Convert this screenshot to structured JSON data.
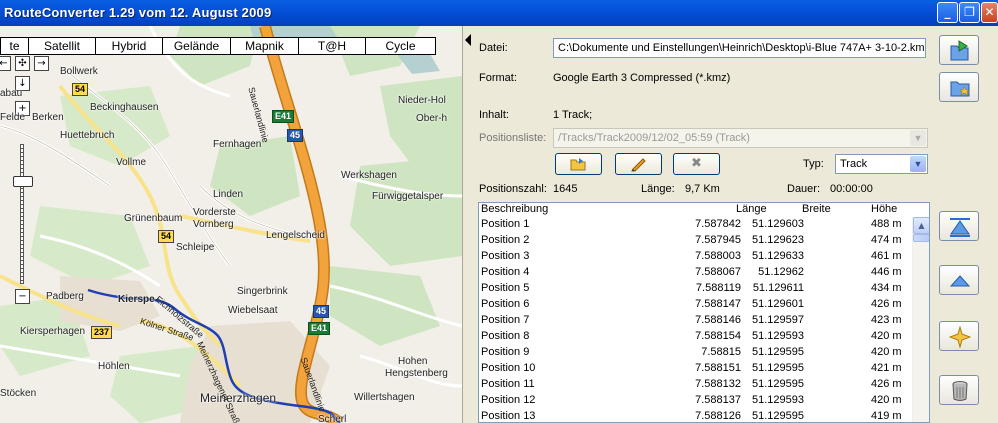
{
  "window": {
    "title": "RouteConverter 1.29 vom 12. August 2009",
    "minimize_icon": "minimize-icon",
    "maximize_icon": "maximize-icon",
    "close_icon": "close-icon"
  },
  "map": {
    "tabs": [
      "te",
      "Satellit",
      "Hybrid",
      "Gelände",
      "Mapnik",
      "T@H",
      "Cycle"
    ],
    "places": [
      {
        "name": "Bollwerk"
      },
      {
        "name": "Beckinghausen"
      },
      {
        "name": "Huettebruch"
      },
      {
        "name": "Vollme"
      },
      {
        "name": "Fernhagen"
      },
      {
        "name": "Linden"
      },
      {
        "name": "Grünenbaum"
      },
      {
        "name": "Vorderste"
      },
      {
        "name": "Vornberg"
      },
      {
        "name": "Schleipe"
      },
      {
        "name": "Lengelscheid"
      },
      {
        "name": "Werkshagen"
      },
      {
        "name": "Fürwiggetalsper"
      },
      {
        "name": "Nieder-Hol"
      },
      {
        "name": "Ober-h"
      },
      {
        "name": "Singerbrink"
      },
      {
        "name": "Wiebelsaat"
      },
      {
        "name": "Padberg"
      },
      {
        "name": "Kierspe"
      },
      {
        "name": "Kiersperhagen"
      },
      {
        "name": "Höhlen"
      },
      {
        "name": "Meinerzhagen"
      },
      {
        "name": "Hohen"
      },
      {
        "name": "Hengstenberg"
      },
      {
        "name": "Willertshagen"
      },
      {
        "name": "Stöcken"
      },
      {
        "name": "Scherl"
      },
      {
        "name": "Felde"
      },
      {
        "name": "Berken"
      },
      {
        "name": "abau"
      }
    ],
    "roads": {
      "a45_name": "Sauerlandlinie",
      "street1": "Kölner Straße",
      "street2": "Meinerzhagener Straße",
      "street3": "Eichholzstraße"
    },
    "shields": {
      "s54a": "54",
      "s54b": "54",
      "s237": "237",
      "e41a": "E41",
      "a45a": "45",
      "a45b": "45",
      "e41b": "E41"
    },
    "colors": {
      "motorway": "#f2a33b",
      "route": "#1f3fb5"
    }
  },
  "details": {
    "datei_label": "Datei:",
    "datei_value": "C:\\Dokumente und Einstellungen\\Heinrich\\Desktop\\i-Blue 747A+ 3-10-2.kmz",
    "format_label": "Format:",
    "format_value": "Google Earth 3 Compressed (*.kmz)",
    "inhalt_label": "Inhalt:",
    "inhalt_value": "1 Track;",
    "positionsliste_label": "Positionsliste:",
    "positionsliste_value": "/Tracks/Track2009/12/02_05:59 (Track)",
    "typ_label": "Typ:",
    "typ_value": "Track",
    "positionszahl_label": "Positionszahl:",
    "positionszahl_value": "1645",
    "laenge_label": "Länge:",
    "laenge_value": "9,7 Km",
    "dauer_label": "Dauer:",
    "dauer_value": "00:00:00"
  },
  "table": {
    "headers": {
      "desc": "Beschreibung",
      "len": "Länge",
      "wid": "Breite",
      "hoe": "Höhe"
    },
    "rows": [
      {
        "desc": "Position 1",
        "len": "7.587842",
        "wid": "51.129603",
        "hoe": "488 m"
      },
      {
        "desc": "Position 2",
        "len": "7.587945",
        "wid": "51.129623",
        "hoe": "474 m"
      },
      {
        "desc": "Position 3",
        "len": "7.588003",
        "wid": "51.129633",
        "hoe": "461 m"
      },
      {
        "desc": "Position 4",
        "len": "7.588067",
        "wid": "51.12962",
        "hoe": "446 m"
      },
      {
        "desc": "Position 5",
        "len": "7.588119",
        "wid": "51.129611",
        "hoe": "434 m"
      },
      {
        "desc": "Position 6",
        "len": "7.588147",
        "wid": "51.129601",
        "hoe": "426 m"
      },
      {
        "desc": "Position 7",
        "len": "7.588146",
        "wid": "51.129597",
        "hoe": "423 m"
      },
      {
        "desc": "Position 8",
        "len": "7.588154",
        "wid": "51.129593",
        "hoe": "420 m"
      },
      {
        "desc": "Position 9",
        "len": "7.58815",
        "wid": "51.129595",
        "hoe": "420 m"
      },
      {
        "desc": "Position 10",
        "len": "7.588151",
        "wid": "51.129595",
        "hoe": "421 m"
      },
      {
        "desc": "Position 11",
        "len": "7.588132",
        "wid": "51.129595",
        "hoe": "426 m"
      },
      {
        "desc": "Position 12",
        "len": "7.588137",
        "wid": "51.129593",
        "hoe": "420 m"
      },
      {
        "desc": "Position 13",
        "len": "7.588126",
        "wid": "51.129595",
        "hoe": "419 m"
      }
    ]
  },
  "icons": {
    "open_file": "open-file-icon",
    "new_file": "new-folder-icon",
    "rename": "pencil-icon",
    "delete": "delete-icon",
    "move_top": "move-top-icon",
    "move_up": "move-up-icon",
    "insert": "insert-star-icon",
    "trash": "trash-icon"
  }
}
